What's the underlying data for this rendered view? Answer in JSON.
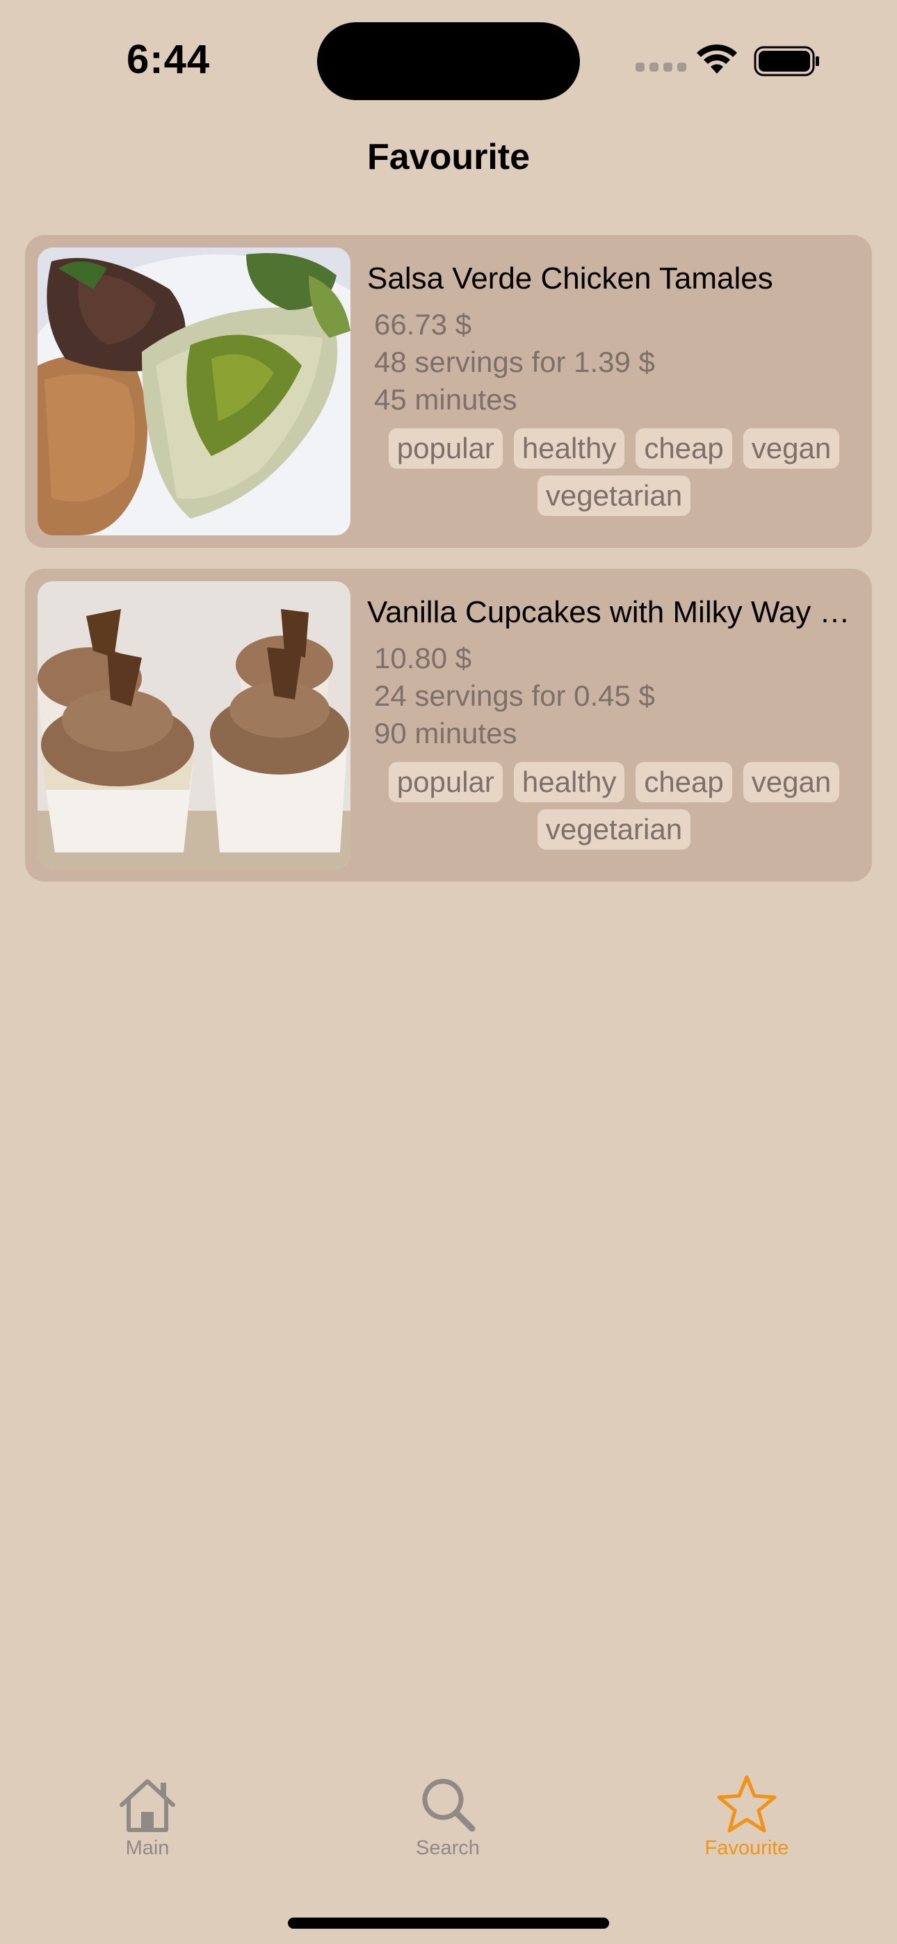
{
  "status_bar": {
    "time": "6:44"
  },
  "header": {
    "title": "Favourite"
  },
  "recipes": [
    {
      "title": "Salsa Verde Chicken Tamales",
      "price": "66.73 $",
      "servings": "48 servings for 1.39 $",
      "time": "45 minutes",
      "tags": [
        "popular",
        "healthy",
        "cheap",
        "vegan",
        "vegetarian"
      ]
    },
    {
      "title": "Vanilla Cupcakes with Milky Way Frosting",
      "price": "10.80 $",
      "servings": "24 servings for 0.45 $",
      "time": "90 minutes",
      "tags": [
        "popular",
        "healthy",
        "cheap",
        "vegan",
        "vegetarian"
      ]
    }
  ],
  "tabbar": {
    "items": [
      {
        "label": "Main",
        "icon": "house-icon",
        "active": false
      },
      {
        "label": "Search",
        "icon": "magnifier-icon",
        "active": false
      },
      {
        "label": "Favourite",
        "icon": "star-icon",
        "active": true
      }
    ]
  },
  "colors": {
    "background": "#dfcdbc",
    "card": "#cbb3a1",
    "tag": "#e7d5c6",
    "accent": "#ef9416",
    "inactive": "#8f8a86"
  }
}
